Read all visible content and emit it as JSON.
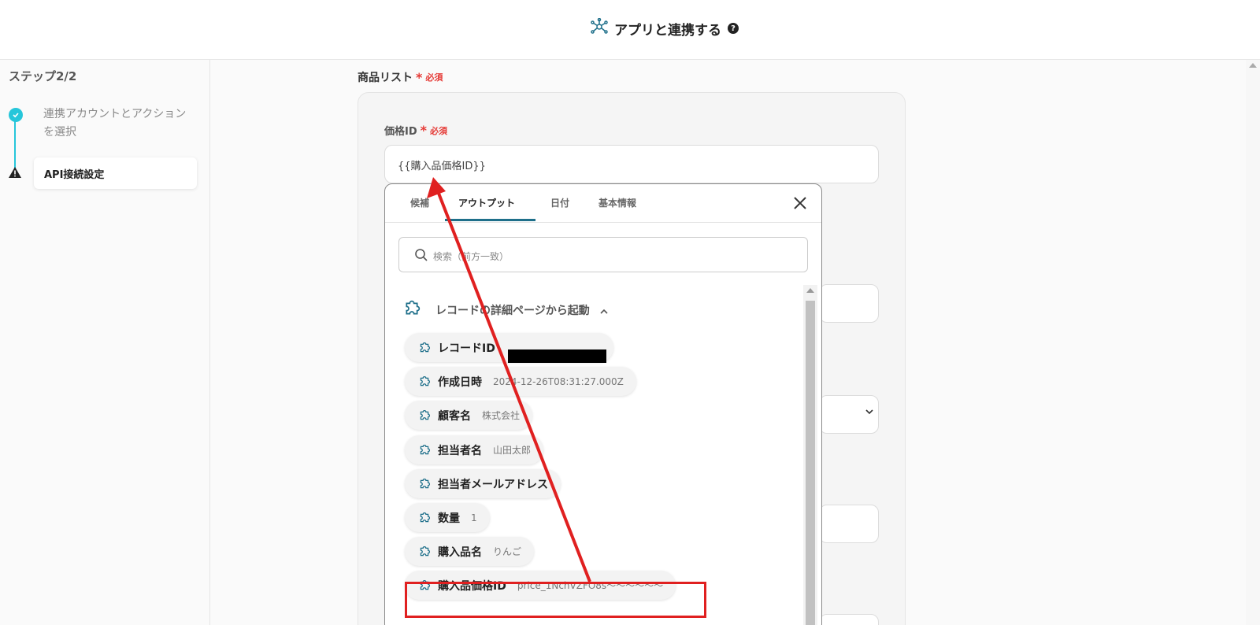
{
  "header": {
    "title": "アプリと連携する",
    "help": "?"
  },
  "sidebar": {
    "step_label": "ステップ2/2",
    "steps": [
      {
        "label": "連携アカウントとアクションを選択",
        "status": "complete"
      },
      {
        "label": "API接続設定",
        "status": "active-warning"
      }
    ]
  },
  "form": {
    "section_label": "商品リスト",
    "required_text": "必須",
    "field_label": "価格ID",
    "price_id_value": "{{購入品価格ID}}"
  },
  "popup": {
    "tabs": [
      {
        "label": "候補"
      },
      {
        "label": "アウトプット",
        "active": true
      },
      {
        "label": "日付"
      },
      {
        "label": "基本情報"
      }
    ],
    "search_placeholder": "検索（前方一致）",
    "group_title": "レコードの詳細ページから起動",
    "items": [
      {
        "label": "レコードID",
        "value": ""
      },
      {
        "label": "作成日時",
        "value": "2024-12-26T08:31:27.000Z"
      },
      {
        "label": "顧客名",
        "value": "株式会社"
      },
      {
        "label": "担当者名",
        "value": "山田太郎"
      },
      {
        "label": "担当者メールアドレス",
        "value": ""
      },
      {
        "label": "数量",
        "value": "1"
      },
      {
        "label": "購入品名",
        "value": "りんご"
      },
      {
        "label": "購入品価格ID",
        "value": "price_1NchVZFO8s～～～～～～"
      }
    ]
  },
  "colors": {
    "accent": "#26c6da",
    "tab_underline": "#1e6f8a",
    "required": "#e53935",
    "annotation": "#e02020"
  }
}
